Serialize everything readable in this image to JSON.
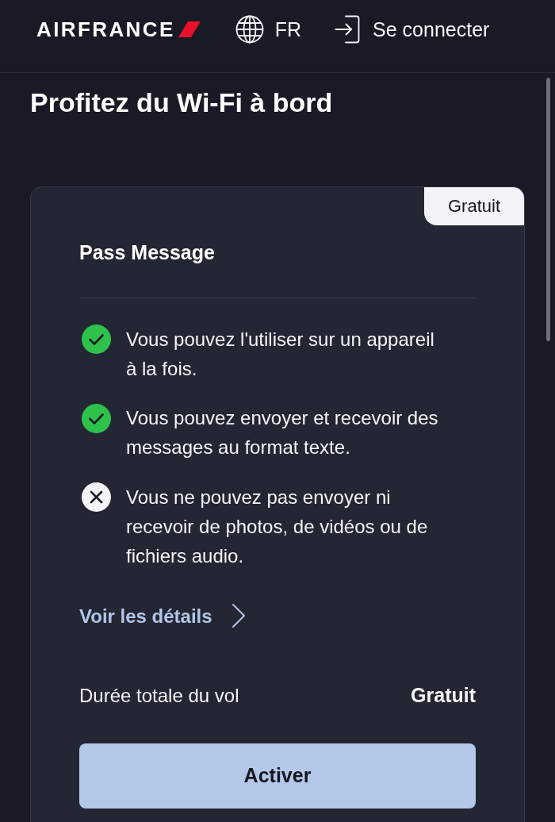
{
  "header": {
    "logo": "AIRFRANCE",
    "language": "FR",
    "login": "Se connecter"
  },
  "title": "Profitez du Wi-Fi à bord",
  "pass_card": {
    "badge": "Gratuit",
    "name": "Pass Message",
    "features": [
      {
        "text": "Vous pouvez l'utiliser sur un appareil à la fois.",
        "included": true
      },
      {
        "text": "Vous pouvez envoyer et recevoir des messages au format texte.",
        "included": true
      },
      {
        "text": "Vous ne pouvez pas envoyer ni recevoir de photos, de vidéos ou de fichiers audio.",
        "included": false
      }
    ],
    "details_link": "Voir les détails",
    "price_row": {
      "label": "Durée totale du vol",
      "value": "Gratuit"
    },
    "button": "Activer"
  }
}
